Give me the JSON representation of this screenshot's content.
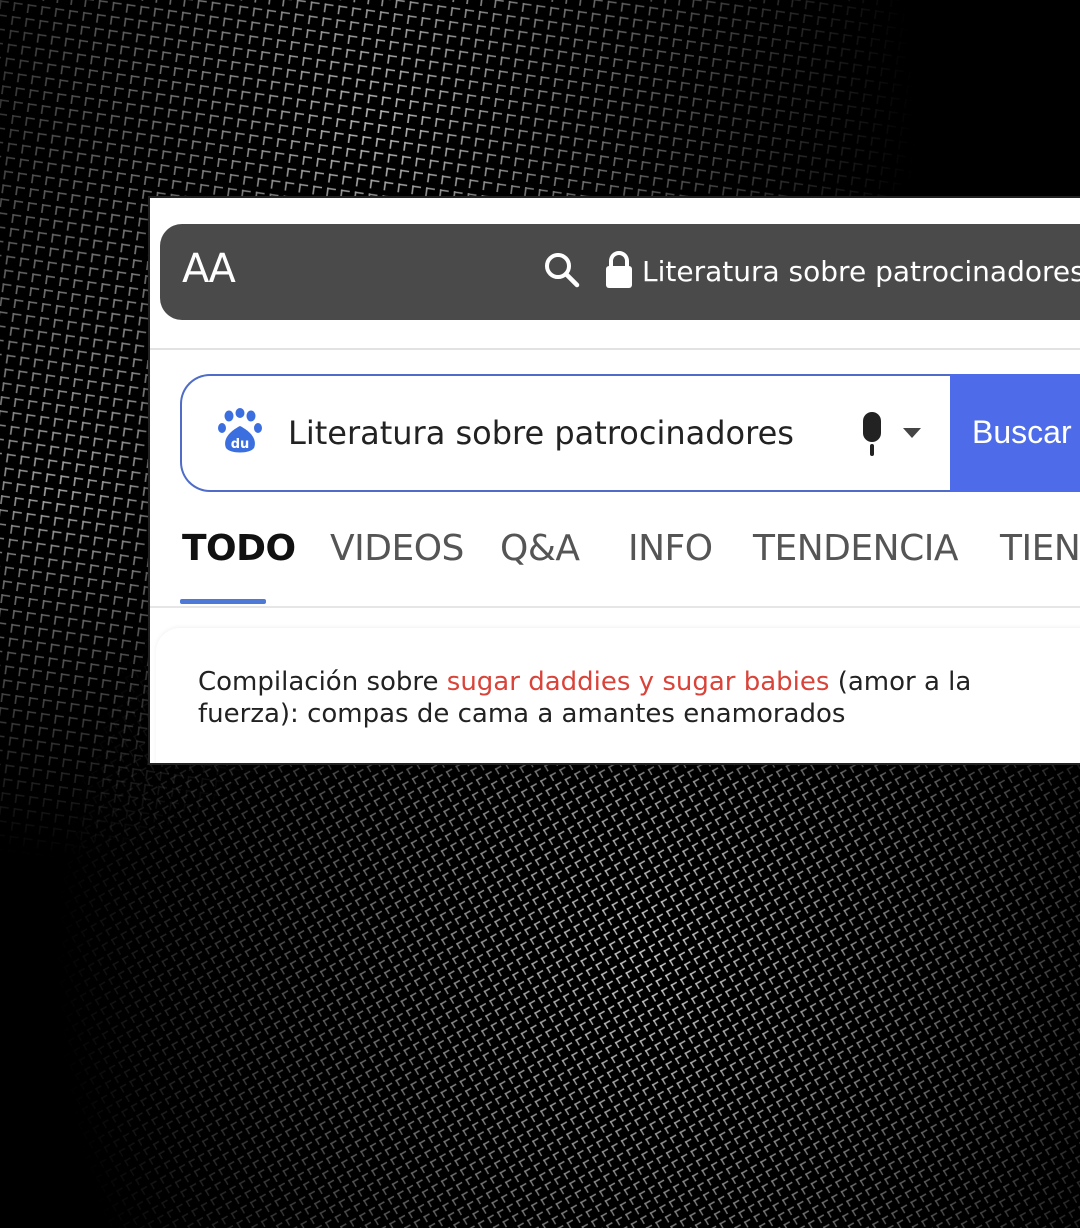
{
  "address_bar": {
    "text_size_button": "AA",
    "url_text": "Literatura sobre patrocinadores"
  },
  "search": {
    "query": "Literatura sobre patrocinadores",
    "button_label": "Buscar"
  },
  "tabs": [
    {
      "label": "TODO",
      "active": true
    },
    {
      "label": "VIDEOS",
      "active": false
    },
    {
      "label": "Q&A",
      "active": false
    },
    {
      "label": "INFO",
      "active": false
    },
    {
      "label": "TENDENCIA",
      "active": false
    },
    {
      "label": "TIEN",
      "active": false
    }
  ],
  "result": {
    "text_before": "Compilación sobre ",
    "highlight": "sugar daddies y sugar babies",
    "text_after": " (amor a la fuerza): compas de cama a amantes enamorados"
  },
  "colors": {
    "accent_blue": "#4e6cea",
    "highlight_red": "#d9443a",
    "address_bar_bg": "#4a4a4a"
  }
}
